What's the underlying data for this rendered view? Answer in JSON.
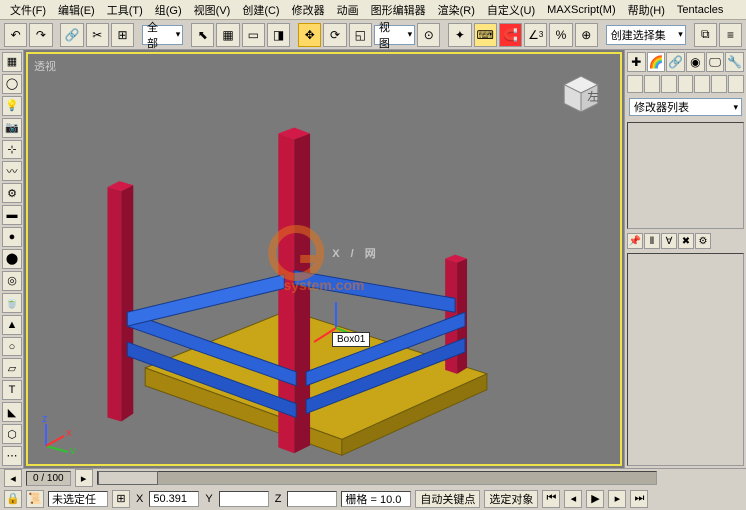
{
  "menu": {
    "file": "文件(F)",
    "edit": "编辑(E)",
    "tools": "工具(T)",
    "group": "组(G)",
    "views": "视图(V)",
    "create": "创建(C)",
    "modifiers": "修改器",
    "animation": "动画",
    "graph": "图形编辑器",
    "render": "渲染(R)",
    "customize": "自定义(U)",
    "maxscript": "MAXScript(M)",
    "help": "帮助(H)",
    "tentacles": "Tentacles"
  },
  "toolbar": {
    "selection_filter": "全部",
    "view_combo": "视图",
    "selection_set": "创建选择集"
  },
  "viewport": {
    "label": "透视",
    "object_label": "Box01"
  },
  "right": {
    "modifier_list": "修改器列表"
  },
  "timeline": {
    "readout": "0  /  100"
  },
  "status": {
    "notselected": "未选定任",
    "x_label": "X",
    "x_val": "50.391",
    "y_label": "Y",
    "z_label": "Z",
    "grid_label": "栅格 = 10.0",
    "autokey": "自动关键点",
    "selobj": "选定对象"
  },
  "watermark": {
    "text": "X / 网",
    "sub": "system.com"
  }
}
